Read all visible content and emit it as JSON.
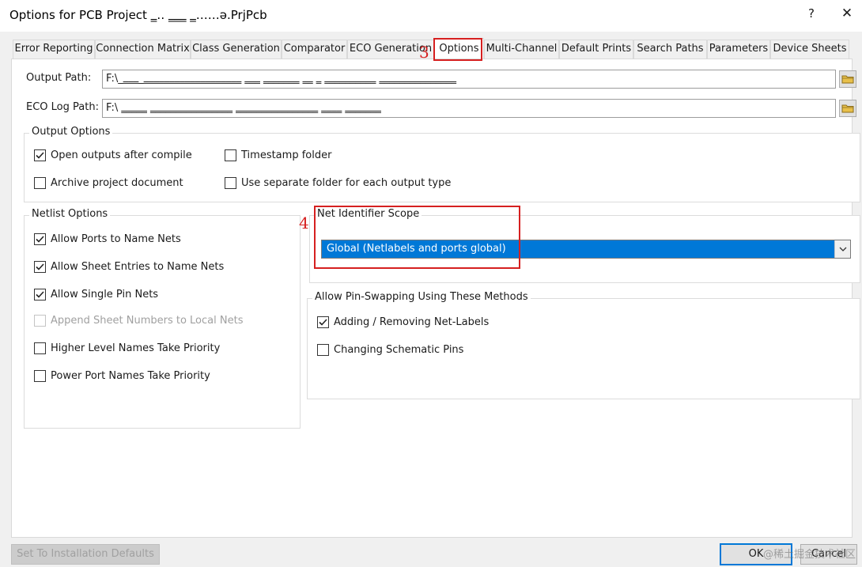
{
  "window": {
    "title": "Options for PCB Project ‗‥ ‗‗‗ ‗……ə.PrjPcb",
    "help_glyph": "?",
    "close_glyph": "✕"
  },
  "tabs": [
    {
      "label": "Error Reporting"
    },
    {
      "label": "Connection Matrix"
    },
    {
      "label": "Class Generation"
    },
    {
      "label": "Comparator"
    },
    {
      "label": "ECO Generation"
    },
    {
      "label": "Options"
    },
    {
      "label": "Multi-Channel"
    },
    {
      "label": "Default Prints"
    },
    {
      "label": "Search Paths"
    },
    {
      "label": "Parameters"
    },
    {
      "label": "Device Sheets"
    }
  ],
  "paths": {
    "output_label": "Output Path:",
    "output_value": "F:\\_‗‗‗_‗‗‗‗‗‗‗‗‗‗‗‗‗‗‗‗‗‗‗ ‗‗‗ ‗‗‗‗‗‗‗ ‗‗ ‗ ‗‗‗‗‗‗‗‗‗‗ ‗‗‗‗‗‗‗‗‗‗‗‗‗‗‗",
    "eco_label": "ECO Log Path:",
    "eco_value": "F:\\ ‗‗‗‗‗ ‗‗‗‗‗‗‗‗‗‗‗‗‗‗‗‗ ‗‗‗‗‗‗‗‗‗‗‗‗‗‗‗‗ ‗‗‗‗ ‗‗‗‗‗‗‗"
  },
  "output_options": {
    "label": "Output Options",
    "open_outputs": "Open outputs after compile",
    "timestamp_folder": "Timestamp folder",
    "archive_document": "Archive project document",
    "separate_folder": "Use separate folder for each output type"
  },
  "netlist_options": {
    "label": "Netlist Options",
    "ports_to_name": "Allow Ports to Name Nets",
    "sheet_entries": "Allow Sheet Entries to Name Nets",
    "single_pin": "Allow Single Pin Nets",
    "append_sheet": "Append Sheet Numbers to Local Nets",
    "higher_level": "Higher Level Names Take Priority",
    "power_port": "Power Port Names Take Priority"
  },
  "net_identifier": {
    "label": "Net Identifier Scope",
    "selected": "Global (Netlabels and ports global)"
  },
  "pin_swapping": {
    "label": "Allow Pin-Swapping Using These Methods",
    "net_labels": "Adding / Removing Net-Labels",
    "schematic_pins": "Changing Schematic Pins"
  },
  "annotations": {
    "step3": "3",
    "step4": "4"
  },
  "buttons": {
    "defaults": "Set To Installation Defaults",
    "ok": "OK",
    "cancel": "Cancel"
  },
  "watermark": "@稀土掘金技术社区",
  "colors": {
    "accent": "#0078d7",
    "annotation_red": "#d62020"
  }
}
